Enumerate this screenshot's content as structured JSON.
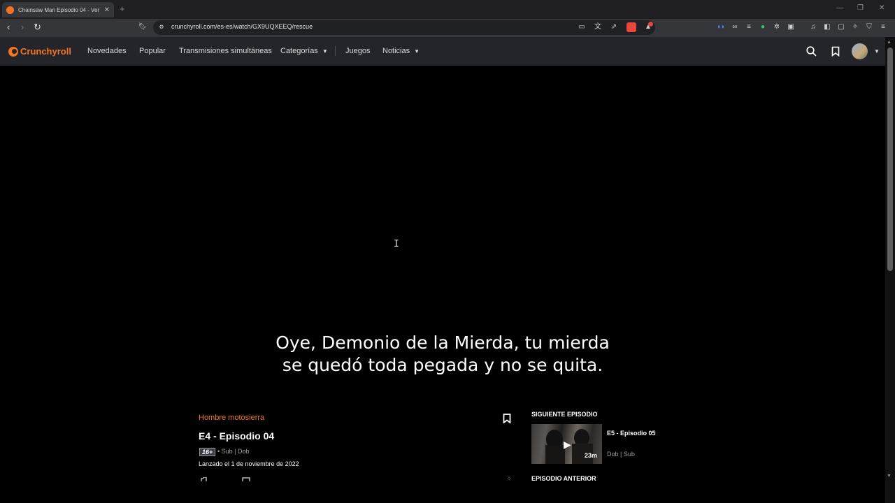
{
  "browser": {
    "tab_title": "Chainsaw Man Episodio 04 - Ver",
    "new_tab": "+",
    "url": "crunchyroll.com/es-es/watch/GX9UQXEEQ/rescue"
  },
  "site": {
    "brand": "Crunchyroll",
    "nav": {
      "novedades": "Novedades",
      "popular": "Popular",
      "simulcasts": "Transmisiones simultáneas",
      "categorias": "Categorías",
      "juegos": "Juegos",
      "noticias": "Noticias"
    }
  },
  "player": {
    "subtitle_line1": "Oye, Demonio de la Mierda, tu mierda",
    "subtitle_line2": "se quedó toda pegada y no se quita."
  },
  "episode": {
    "series": "Hombre motosierra",
    "title": "E4 - Episodio 04",
    "rating": "16+",
    "audio": "• Sub | Dob",
    "release": "Lanzado el 1 de noviembre de 2022"
  },
  "next": {
    "heading": "SIGUIENTE EPISODIO",
    "title": "E5 - Episodio 05",
    "duration": "23m",
    "audio": "Dob | Sub"
  },
  "prev": {
    "heading": "EPISODIO ANTERIOR"
  },
  "colors": {
    "accent": "#f47521",
    "header_bg": "#23252b"
  }
}
